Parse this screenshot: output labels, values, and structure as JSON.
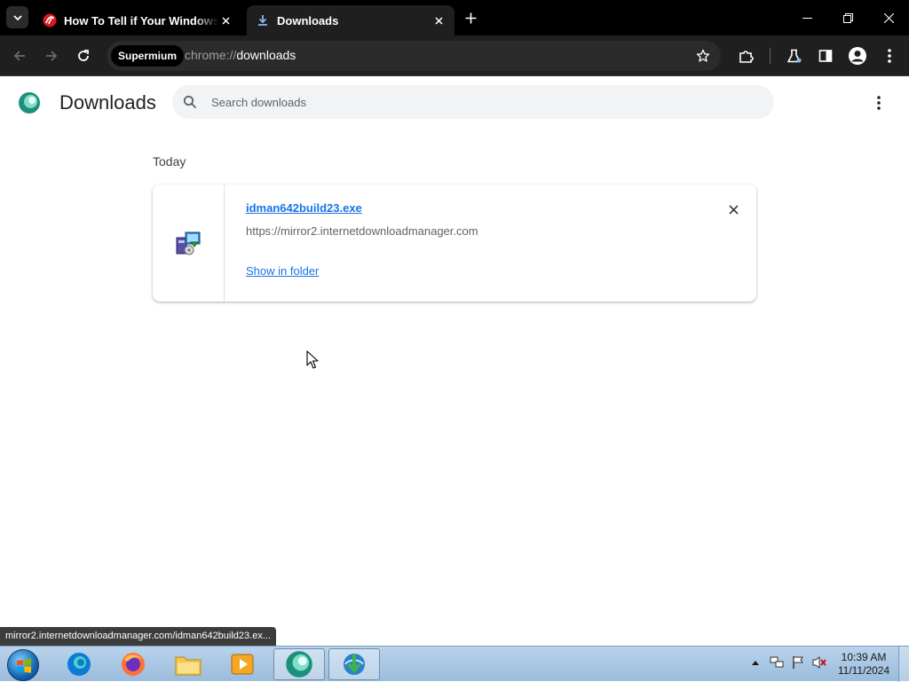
{
  "browser": {
    "tabs": [
      {
        "title": "How To Tell if Your Windows P",
        "favicon": "trend-micro-icon",
        "active": false
      },
      {
        "title": "Downloads",
        "favicon": "download-icon",
        "active": true
      }
    ],
    "omnibox": {
      "chip_label": "Supermium",
      "url_scheme": "chrome://",
      "url_path": "downloads"
    }
  },
  "downloads_page": {
    "title": "Downloads",
    "search_placeholder": "Search downloads",
    "section_label": "Today",
    "items": [
      {
        "file_name": "idman642build23.exe",
        "source_url": "https://mirror2.internetdownloadmanager.com",
        "action_label": "Show in folder"
      }
    ]
  },
  "status_bar": {
    "text": "mirror2.internetdownloadmanager.com/idman642build23.ex..."
  },
  "taskbar": {
    "clock_time": "10:39 AM",
    "clock_date": "11/11/2024",
    "apps": [
      "ie-edge-icon",
      "firefox-icon",
      "file-explorer-icon",
      "media-player-icon",
      "supermium-icon",
      "idm-icon"
    ]
  },
  "colors": {
    "accent": "#1a73e8",
    "titlebar": "#000000",
    "toolbar": "#1f1f1f"
  }
}
